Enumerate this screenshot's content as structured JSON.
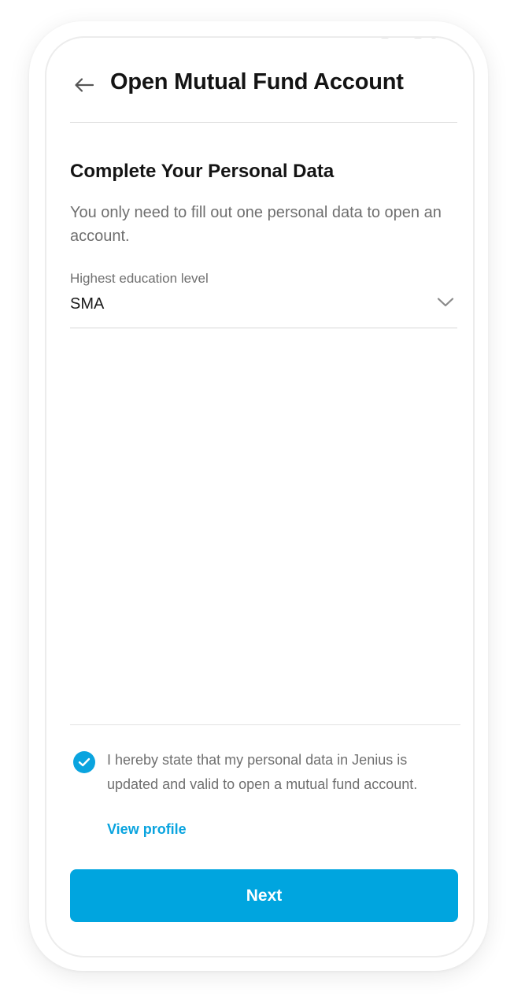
{
  "header": {
    "title": "Open Mutual Fund Account",
    "back_icon": "arrow-left-icon"
  },
  "section": {
    "title": "Complete Your Personal Data",
    "description": "You only need to fill out one personal data to open an account."
  },
  "education_field": {
    "label": "Highest education level",
    "value": "SMA",
    "dropdown_icon": "chevron-down-icon"
  },
  "consent": {
    "checked": true,
    "text": "I hereby state that my personal data in Jenius is updated and valid to open a mutual fund account.",
    "link_label": "View profile",
    "check_icon": "check-icon"
  },
  "actions": {
    "next_label": "Next"
  },
  "colors": {
    "accent": "#00a5df",
    "title_text": "#141414",
    "secondary_text": "#6f6f6f",
    "divider": "#e2e2e2"
  }
}
